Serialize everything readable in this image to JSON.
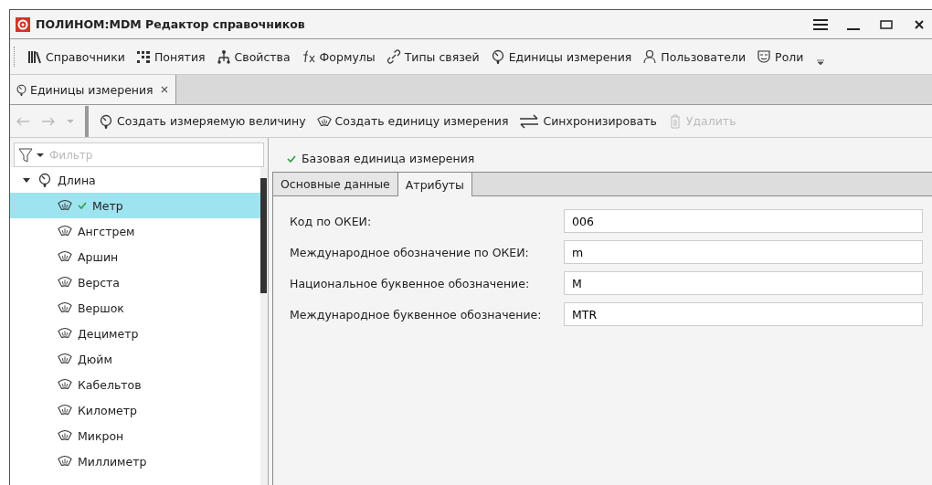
{
  "window": {
    "title": "ПОЛИНОМ:MDM Редактор справочников"
  },
  "toolbar": [
    {
      "kind": "books",
      "label": "Справочники"
    },
    {
      "kind": "grid",
      "label": "Понятия"
    },
    {
      "kind": "tree",
      "label": "Свойства"
    },
    {
      "kind": "fx",
      "label": "Формулы"
    },
    {
      "kind": "link",
      "label": "Типы связей"
    },
    {
      "kind": "gauge",
      "label": "Единицы измерения"
    },
    {
      "kind": "user",
      "label": "Пользователи"
    },
    {
      "kind": "mask",
      "label": "Роли"
    }
  ],
  "doc_tabs": [
    {
      "label": "Единицы измерения",
      "selected": true
    }
  ],
  "actions": [
    {
      "kind": "gauge",
      "label": "Создать измеряемую величину",
      "disabled": false
    },
    {
      "kind": "unit",
      "label": "Создать единицу измерения",
      "disabled": false
    },
    {
      "kind": "sync",
      "label": "Синхронизировать",
      "disabled": false
    },
    {
      "kind": "trash",
      "label": "Удалить",
      "disabled": true
    }
  ],
  "filter": {
    "placeholder": "Фильтр"
  },
  "tree": [
    {
      "label": "Длина",
      "expanded": true,
      "selected": false,
      "children": [
        {
          "label": "Метр",
          "base": true,
          "selected": true
        },
        {
          "label": "Ангстрем",
          "base": false,
          "selected": false
        },
        {
          "label": "Аршин",
          "base": false,
          "selected": false
        },
        {
          "label": "Верста",
          "base": false,
          "selected": false
        },
        {
          "label": "Вершок",
          "base": false,
          "selected": false
        },
        {
          "label": "Дециметр",
          "base": false,
          "selected": false
        },
        {
          "label": "Дюйм",
          "base": false,
          "selected": false
        },
        {
          "label": "Кабельтов",
          "base": false,
          "selected": false
        },
        {
          "label": "Километр",
          "base": false,
          "selected": false
        },
        {
          "label": "Микрон",
          "base": false,
          "selected": false
        },
        {
          "label": "Миллиметр",
          "base": false,
          "selected": false
        }
      ]
    }
  ],
  "base_unit": {
    "label": "Базовая единица измерения",
    "checked": true
  },
  "detail_tabs": [
    {
      "label": "Основные данные",
      "selected": false
    },
    {
      "label": "Атрибуты",
      "selected": true
    }
  ],
  "fields": [
    {
      "label": "Код по ОКЕИ:",
      "value": "006"
    },
    {
      "label": "Международное обозначение по ОКЕИ:",
      "value": "m"
    },
    {
      "label": "Национальное буквенное обозначение:",
      "value": "М"
    },
    {
      "label": "Международное буквенное обозначение:",
      "value": "MTR"
    }
  ]
}
